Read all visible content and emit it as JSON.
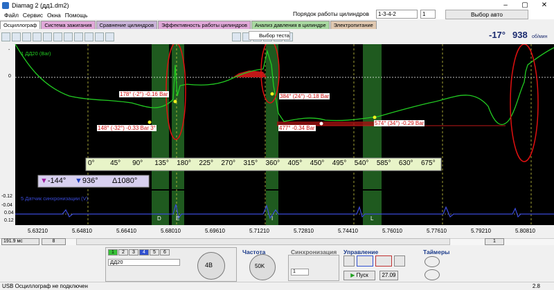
{
  "window": {
    "title": "Diamag 2 (дд1.dm2)",
    "controls": [
      "–",
      "▢",
      "✕"
    ]
  },
  "menu": [
    "Файл",
    "Сервис",
    "Окна",
    "Помощь"
  ],
  "cylinder_order": {
    "label": "Порядок работы цилиндров",
    "value": "1-3-4-2",
    "spin": "1",
    "auto_label": "Выбор авто"
  },
  "tabs": [
    {
      "label": "Осциллограф",
      "color": "#ffffff"
    },
    {
      "label": "Система зажигания",
      "color": "#e0a8d8"
    },
    {
      "label": "Сравнение цилиндров",
      "color": "#c9b3d8"
    },
    {
      "label": "Эффективность работы цилиндров",
      "color": "#e0a8d8"
    },
    {
      "label": "Анализ давления в цилиндре",
      "color": "#a8d8a0"
    },
    {
      "label": "Электропитание",
      "color": "#e0c8b0"
    }
  ],
  "toolbar": {
    "test_select": "Выбор теста",
    "angle": "-17°",
    "rpm": "938",
    "rpm_unit": "об/мин"
  },
  "plot": {
    "channel1_label": "1 ДД20 (Bar)",
    "channel1_zero": "0",
    "channel1_neg": "-",
    "channel5_label": "5 Датчик синхронизации (V)",
    "ch5_ticks": [
      "-0.12",
      "-0.04",
      "0.04",
      "0.12"
    ],
    "annotations": [
      {
        "text": "178° (-2°) -0.16 Bar"
      },
      {
        "text": "148° (-32°) -0.33 Bar 3°"
      },
      {
        "text": "384° (24°) -0.18 Bar"
      },
      {
        "text": "477° -0.34 Bar"
      },
      {
        "text": "574° (34°) -0.29 Bar"
      }
    ],
    "degree_scale": [
      "0°",
      "45°",
      "90°",
      "135°",
      "180°",
      "225°",
      "270°",
      "315°",
      "360°",
      "405°",
      "450°",
      "495°",
      "540°",
      "585°",
      "630°",
      "675°"
    ],
    "markers": {
      "m1": "-144°",
      "m2": "936°",
      "delta": "1080°"
    },
    "zone_letters": [
      "D",
      "E",
      "I",
      "L"
    ],
    "time_ticks": [
      "5.63210",
      "5.64810",
      "5.66410",
      "5.68010",
      "5.69610",
      "5.71210",
      "5.72810",
      "5.74410",
      "5.76010",
      "5.77610",
      "5.79210",
      "5.80810"
    ]
  },
  "controls": {
    "timebase": "191.9 мс",
    "channel_spin": "8",
    "channel_buttons": [
      "1",
      "2",
      "3",
      "4",
      "5",
      "6"
    ],
    "channel_name": "ДД20",
    "voltage_title": "",
    "voltage_labels": [
      "10В",
      "20В",
      "50В",
      "100В",
      "200В",
      "500В",
      "1В",
      "0.5В",
      "0.2В",
      "0.1В"
    ],
    "voltage_value": "4В",
    "freq_title": "Частота",
    "freq_labels": [
      "100K",
      "250K",
      "333K",
      "500K",
      "50K",
      "1K",
      "10K",
      "5K"
    ],
    "freq_value": "50K",
    "sync_title": "Синхронизация",
    "sync_value": "1",
    "control_title": "Управление",
    "start_label": "Пуск",
    "date_label": "27.09",
    "timers_title": "Таймеры",
    "page_value": "1",
    "version": "2.8"
  },
  "status": {
    "text": "USB Осциллограф не подключен"
  }
}
